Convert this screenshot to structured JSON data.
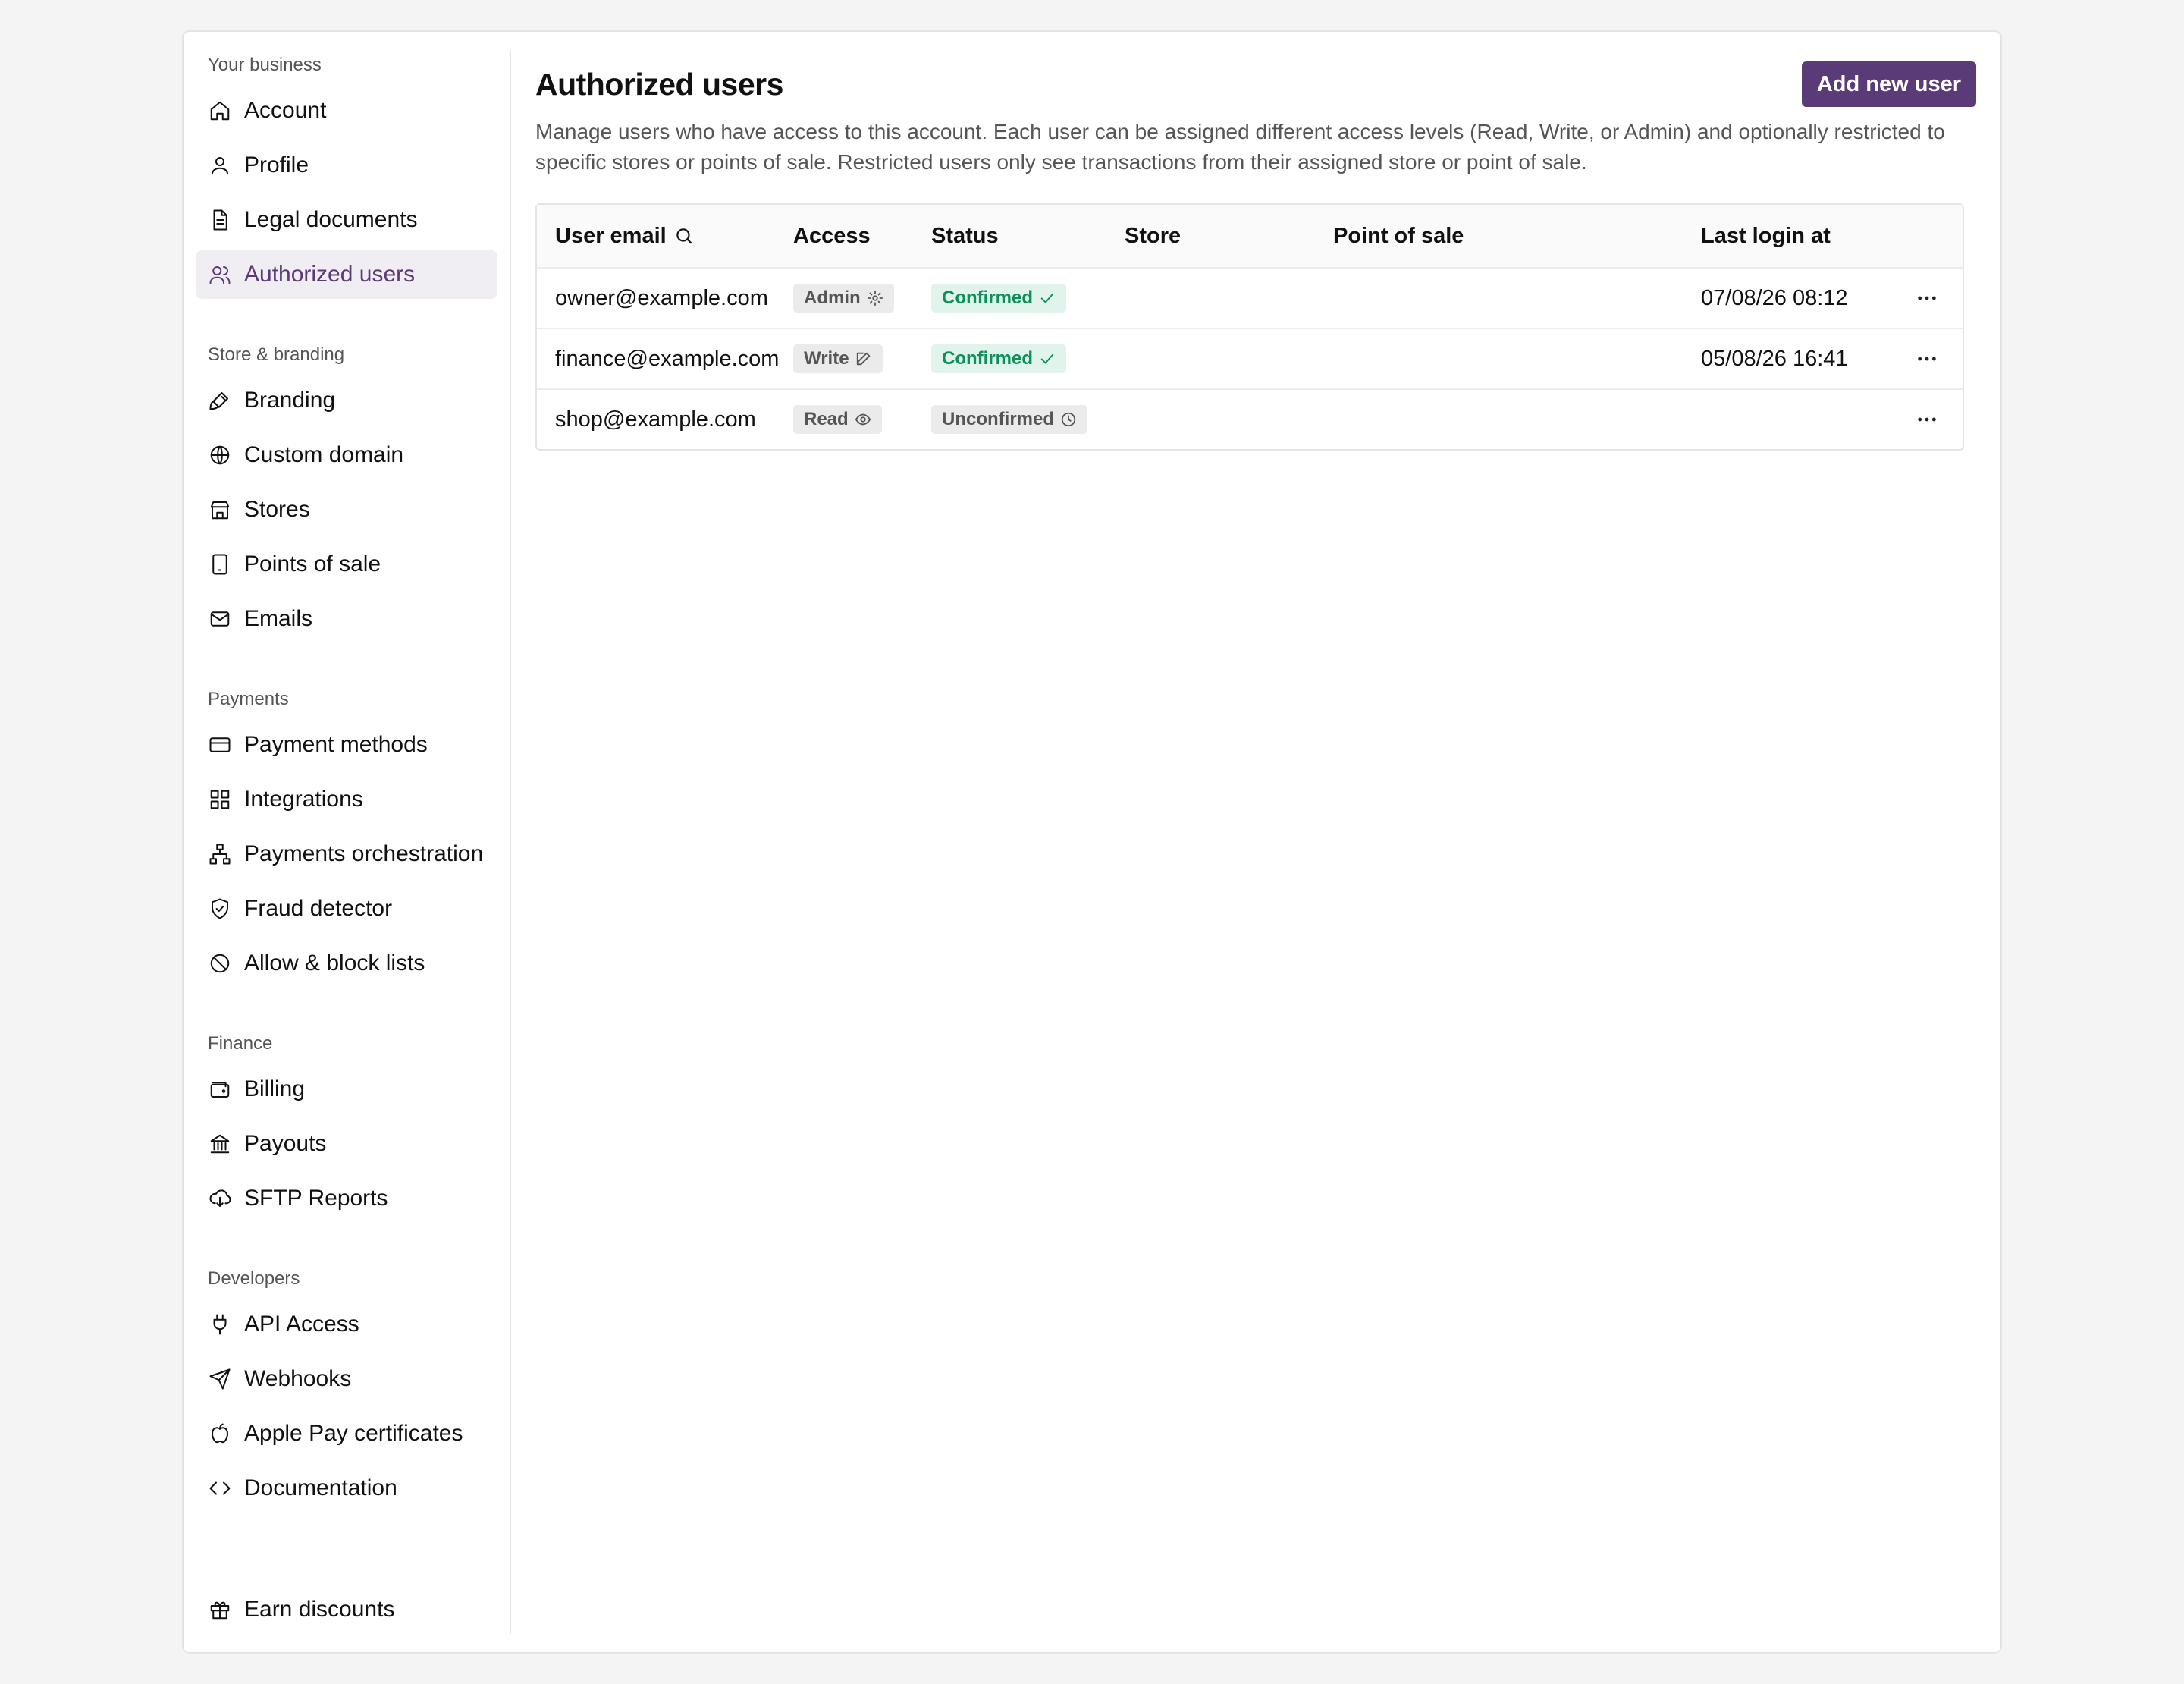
{
  "sidebar": {
    "sections": [
      {
        "title": "Your business",
        "items": [
          {
            "label": "Account",
            "icon": "home-icon"
          },
          {
            "label": "Profile",
            "icon": "user-icon"
          },
          {
            "label": "Legal documents",
            "icon": "document-icon"
          },
          {
            "label": "Authorized users",
            "icon": "users-icon",
            "active": true
          }
        ]
      },
      {
        "title": "Store & branding",
        "items": [
          {
            "label": "Branding",
            "icon": "brush-icon"
          },
          {
            "label": "Custom domain",
            "icon": "globe-icon"
          },
          {
            "label": "Stores",
            "icon": "store-icon"
          },
          {
            "label": "Points of sale",
            "icon": "tablet-icon"
          },
          {
            "label": "Emails",
            "icon": "mail-icon"
          }
        ]
      },
      {
        "title": "Payments",
        "items": [
          {
            "label": "Payment methods",
            "icon": "credit-card-icon"
          },
          {
            "label": "Integrations",
            "icon": "grid-icon"
          },
          {
            "label": "Payments orchestration",
            "icon": "network-icon"
          },
          {
            "label": "Fraud detector",
            "icon": "shield-check-icon"
          },
          {
            "label": "Allow & block lists",
            "icon": "ban-icon"
          }
        ]
      },
      {
        "title": "Finance",
        "items": [
          {
            "label": "Billing",
            "icon": "wallet-icon"
          },
          {
            "label": "Payouts",
            "icon": "bank-icon"
          },
          {
            "label": "SFTP Reports",
            "icon": "cloud-download-icon"
          }
        ]
      },
      {
        "title": "Developers",
        "items": [
          {
            "label": "API Access",
            "icon": "plug-icon"
          },
          {
            "label": "Webhooks",
            "icon": "send-icon"
          },
          {
            "label": "Apple Pay certificates",
            "icon": "apple-icon"
          },
          {
            "label": "Documentation",
            "icon": "code-icon"
          }
        ]
      }
    ],
    "bottom_item": {
      "label": "Earn discounts",
      "icon": "gift-icon"
    }
  },
  "main": {
    "title": "Authorized users",
    "add_button": "Add new user",
    "description": "Manage users who have access to this account. Each user can be assigned different access levels (Read, Write, or Admin) and optionally restricted to specific stores or points of sale. Restricted users only see transactions from their assigned store or point of sale.",
    "table": {
      "headers": [
        "User email",
        "Access",
        "Status",
        "Store",
        "Point of sale",
        "Last login at"
      ],
      "rows": [
        {
          "email": "owner@example.com",
          "access": "Admin",
          "access_icon": "gear-icon",
          "status": "Confirmed",
          "status_type": "confirmed",
          "store": "",
          "pos": "",
          "last_login": "07/08/26 08:12"
        },
        {
          "email": "finance@example.com",
          "access": "Write",
          "access_icon": "edit-icon",
          "status": "Confirmed",
          "status_type": "confirmed",
          "store": "",
          "pos": "",
          "last_login": "05/08/26 16:41"
        },
        {
          "email": "shop@example.com",
          "access": "Read",
          "access_icon": "eye-icon",
          "status": "Unconfirmed",
          "status_type": "unconfirmed",
          "store": "",
          "pos": "",
          "last_login": ""
        }
      ]
    }
  },
  "colors": {
    "accent": "#5b3a78",
    "confirmed": "#0d8f5a",
    "confirmed_bg": "#e0f4ec"
  }
}
